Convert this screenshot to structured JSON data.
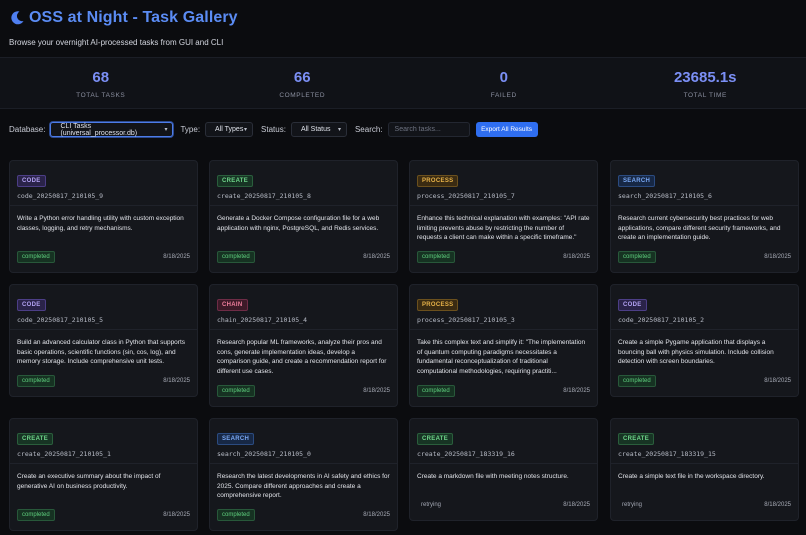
{
  "header": {
    "title": "OSS at Night - Task Gallery",
    "subtitle": "Browse your overnight AI-processed tasks from GUI and CLI"
  },
  "stats": [
    {
      "value": "68",
      "label": "TOTAL TASKS"
    },
    {
      "value": "66",
      "label": "COMPLETED"
    },
    {
      "value": "0",
      "label": "FAILED"
    },
    {
      "value": "23685.1s",
      "label": "TOTAL TIME"
    }
  ],
  "controls": {
    "database_label": "Database:",
    "database_value": "CLI Tasks (universal_processor.db)",
    "type_label": "Type:",
    "type_value": "All Types",
    "status_label": "Status:",
    "status_value": "All Status",
    "search_label": "Search:",
    "search_placeholder": "Search tasks...",
    "export_label": "Export All Results"
  },
  "cards": [
    {
      "badge": "CODE",
      "kind": "code",
      "id": "code_20250817_210105_9",
      "desc": "Write a Python error handling utility with custom exception classes, logging, and retry mechanisms.",
      "status": "completed",
      "date": "8/18/2025"
    },
    {
      "badge": "CREATE",
      "kind": "create",
      "id": "create_20250817_210105_8",
      "desc": "Generate a Docker Compose configuration file for a web application with nginx, PostgreSQL, and Redis services.",
      "status": "completed",
      "date": "8/18/2025"
    },
    {
      "badge": "PROCESS",
      "kind": "process",
      "id": "process_20250817_210105_7",
      "desc": "Enhance this technical explanation with examples: \"API rate limiting prevents abuse by restricting the number of requests a client can make within a specific timeframe.\"",
      "status": "completed",
      "date": "8/18/2025"
    },
    {
      "badge": "SEARCH",
      "kind": "search",
      "id": "search_20250817_210105_6",
      "desc": "Research current cybersecurity best practices for web applications, compare different security frameworks, and create an implementation guide.",
      "status": "completed",
      "date": "8/18/2025"
    },
    {
      "badge": "CODE",
      "kind": "code",
      "id": "code_20250817_210105_5",
      "desc": "Build an advanced calculator class in Python that supports basic operations, scientific functions (sin, cos, log), and memory storage. Include comprehensive unit tests.",
      "status": "completed",
      "date": "8/18/2025"
    },
    {
      "badge": "CHAIN",
      "kind": "chain",
      "id": "chain_20250817_210105_4",
      "desc": "Research popular ML frameworks, analyze their pros and cons, generate implementation ideas, develop a comparison guide, and create a recommendation report for different use cases.",
      "status": "completed",
      "date": "8/18/2025"
    },
    {
      "badge": "PROCESS",
      "kind": "process",
      "id": "process_20250817_210105_3",
      "desc": "Take this complex text and simplify it: \"The implementation of quantum computing paradigms necessitates a fundamental reconceptualization of traditional computational methodologies, requiring practiti...",
      "status": "completed",
      "date": "8/18/2025"
    },
    {
      "badge": "CODE",
      "kind": "code",
      "id": "code_20250817_210105_2",
      "desc": "Create a simple Pygame application that displays a bouncing ball with physics simulation. Include collision detection with screen boundaries.",
      "status": "completed",
      "date": "8/18/2025"
    },
    {
      "badge": "CREATE",
      "kind": "create",
      "id": "create_20250817_210105_1",
      "desc": "Create an executive summary about the impact of generative AI on business productivity.",
      "status": "completed",
      "date": "8/18/2025"
    },
    {
      "badge": "SEARCH",
      "kind": "search",
      "id": "search_20250817_210105_0",
      "desc": "Research the latest developments in AI safety and ethics for 2025. Compare different approaches and create a comprehensive report.",
      "status": "completed",
      "date": "8/18/2025"
    },
    {
      "badge": "CREATE",
      "kind": "create",
      "id": "create_20250817_183319_16",
      "desc": "Create a markdown file with meeting notes structure.",
      "status": "retrying",
      "date": "8/18/2025"
    },
    {
      "badge": "CREATE",
      "kind": "create",
      "id": "create_20250817_183319_15",
      "desc": "Create a simple text file in the workspace directory.",
      "status": "retrying",
      "date": "8/18/2025"
    }
  ]
}
